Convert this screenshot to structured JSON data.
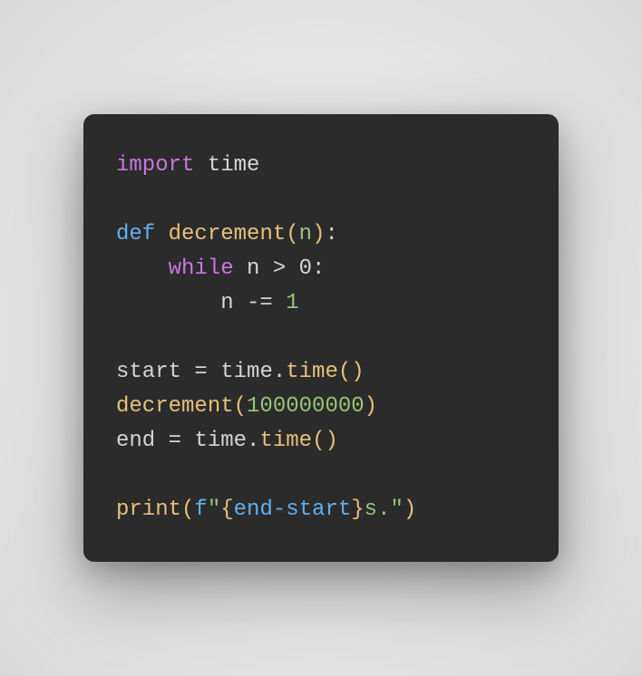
{
  "code": {
    "line1": {
      "kw_import": "import",
      "module": " time"
    },
    "line2": "",
    "line3": {
      "kw_def": "def",
      "space1": " ",
      "fname": "decrement",
      "lparen": "(",
      "param": "n",
      "rparen": ")",
      "colon": ":"
    },
    "line4": {
      "indent": "    ",
      "kw_while": "while",
      "cond": " n > 0",
      "colon": ":"
    },
    "line5": {
      "indent": "        ",
      "stmt": "n -= ",
      "num": "1"
    },
    "line6": "",
    "line7": {
      "var": "start",
      "eq": " = ",
      "mod": "time",
      "dot": ".",
      "fn": "time",
      "parens": "()"
    },
    "line8": {
      "fn": "decrement",
      "lparen": "(",
      "arg": "100000000",
      "rparen": ")"
    },
    "line9": {
      "var": "end",
      "eq": " = ",
      "mod": "time",
      "dot": ".",
      "fn": "time",
      "parens": "()"
    },
    "line10": "",
    "line11": {
      "fn": "print",
      "lparen": "(",
      "fprefix": "f",
      "q1": "\"",
      "lbrace": "{",
      "expr": "end-start",
      "rbrace": "}",
      "text": "s.",
      "q2": "\"",
      "rparen": ")"
    }
  }
}
